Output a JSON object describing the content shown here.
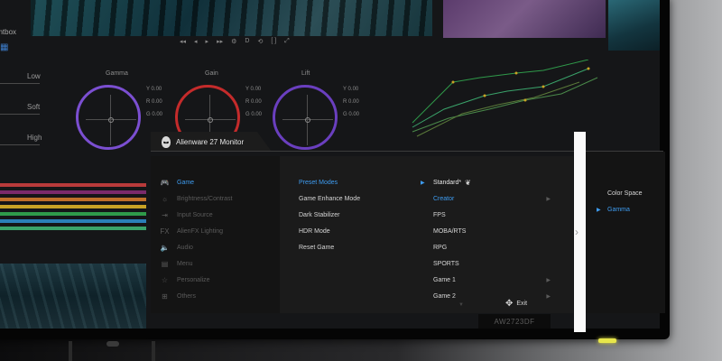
{
  "background_app": {
    "lightbox_label": "ghtbox",
    "transport_icons": [
      "◂◂",
      "◂",
      "▸",
      "▸▸",
      "⚙",
      "D",
      "⟲",
      "[ ]",
      "⤢"
    ],
    "tone_labels": [
      "Low",
      "Soft",
      "High"
    ],
    "wheels": [
      {
        "title": "Gamma",
        "color": "#7b4fd1",
        "values": [
          "Y 0.00",
          "R 0.00",
          "G 0.00"
        ]
      },
      {
        "title": "Gain",
        "color": "#c42b2b",
        "values": [
          "Y 0.00",
          "R 0.00",
          "G 0.00"
        ]
      },
      {
        "title": "Lift",
        "color": "#6a3fbf",
        "values": [
          "Y 0.00",
          "R 0.00",
          "G 0.00"
        ]
      }
    ],
    "bar_colors": [
      "#b83a3a",
      "#7a2a6b",
      "#c0702a",
      "#c9a325",
      "#2f9a4a",
      "#2a7fb8",
      "#3aa36a"
    ]
  },
  "osd": {
    "title": "Alienware 27 Monitor",
    "menu": [
      {
        "label": "Game",
        "icon": "gamepad-icon",
        "glyph": "🎮",
        "active": true
      },
      {
        "label": "Brightness/Contrast",
        "icon": "brightness-icon",
        "glyph": "☼",
        "active": false
      },
      {
        "label": "Input Source",
        "icon": "input-icon",
        "glyph": "⇥",
        "active": false
      },
      {
        "label": "AlienFX Lighting",
        "icon": "fx-icon",
        "glyph": "FX",
        "active": false
      },
      {
        "label": "Audio",
        "icon": "speaker-icon",
        "glyph": "🔈",
        "active": false
      },
      {
        "label": "Menu",
        "icon": "menu-icon",
        "glyph": "▤",
        "active": false
      },
      {
        "label": "Personalize",
        "icon": "star-icon",
        "glyph": "☆",
        "active": false
      },
      {
        "label": "Others",
        "icon": "others-icon",
        "glyph": "⊞",
        "active": false
      }
    ],
    "submenu": [
      {
        "label": "Preset Modes",
        "active": true
      },
      {
        "label": "Game Enhance Mode",
        "active": false
      },
      {
        "label": "Dark Stabilizer",
        "active": false
      },
      {
        "label": "HDR Mode",
        "active": false
      },
      {
        "label": "Reset Game",
        "active": false
      }
    ],
    "options": [
      {
        "label": "Standard*",
        "state": "selected",
        "has_sub": false
      },
      {
        "label": "Creator",
        "state": "highlight",
        "has_sub": true
      },
      {
        "label": "FPS",
        "state": "normal",
        "has_sub": false
      },
      {
        "label": "MOBA/RTS",
        "state": "normal",
        "has_sub": false
      },
      {
        "label": "RPG",
        "state": "normal",
        "has_sub": false
      },
      {
        "label": "SPORTS",
        "state": "normal",
        "has_sub": false
      },
      {
        "label": "Game 1",
        "state": "normal",
        "has_sub": true
      },
      {
        "label": "Game 2",
        "state": "normal",
        "has_sub": true
      }
    ],
    "exit_label": "Exit",
    "creator_options": [
      {
        "label": "Color Space",
        "active": false
      },
      {
        "label": "Gamma",
        "active": true
      }
    ],
    "accent_color": "#3e9cf0"
  },
  "monitor": {
    "model_label": "AW2723DF",
    "led_color": "#e8e64a"
  }
}
